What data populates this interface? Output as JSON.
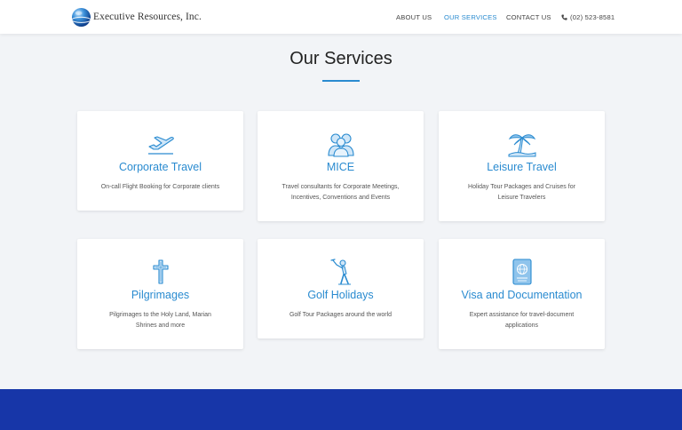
{
  "header": {
    "logo_text": "Executive Resources, Inc.",
    "nav": [
      {
        "label": "ABOUT US"
      },
      {
        "label": "OUR SERVICES"
      },
      {
        "label": "CONTACT US"
      }
    ],
    "phone": "(02) 523-8581"
  },
  "colors": {
    "accent": "#2a8bd0",
    "icon_light": "#8fc4ec",
    "footer_band": "#1736a8",
    "background": "#f2f4f7"
  },
  "main": {
    "title": "Our Services",
    "services": [
      {
        "icon": "airplane-icon",
        "title": "Corporate Travel",
        "desc": "On-call Flight Booking for Corporate clients"
      },
      {
        "icon": "group-people-icon",
        "title": "MICE",
        "desc": "Travel consultants for Corporate Meetings, Incentives, Conventions and Events"
      },
      {
        "icon": "palm-tree-icon",
        "title": "Leisure Travel",
        "desc": "Holiday Tour Packages and Cruises for Leisure Travelers"
      },
      {
        "icon": "cross-icon",
        "title": "Pilgrimages",
        "desc": "Pilgrimages to the Holy Land, Marian Shrines and more"
      },
      {
        "icon": "golfer-icon",
        "title": "Golf Holidays",
        "desc": "Golf Tour Packages around the world"
      },
      {
        "icon": "passport-icon",
        "title": "Visa and Documentation",
        "desc": "Expert assistance for travel-document applications"
      }
    ]
  }
}
